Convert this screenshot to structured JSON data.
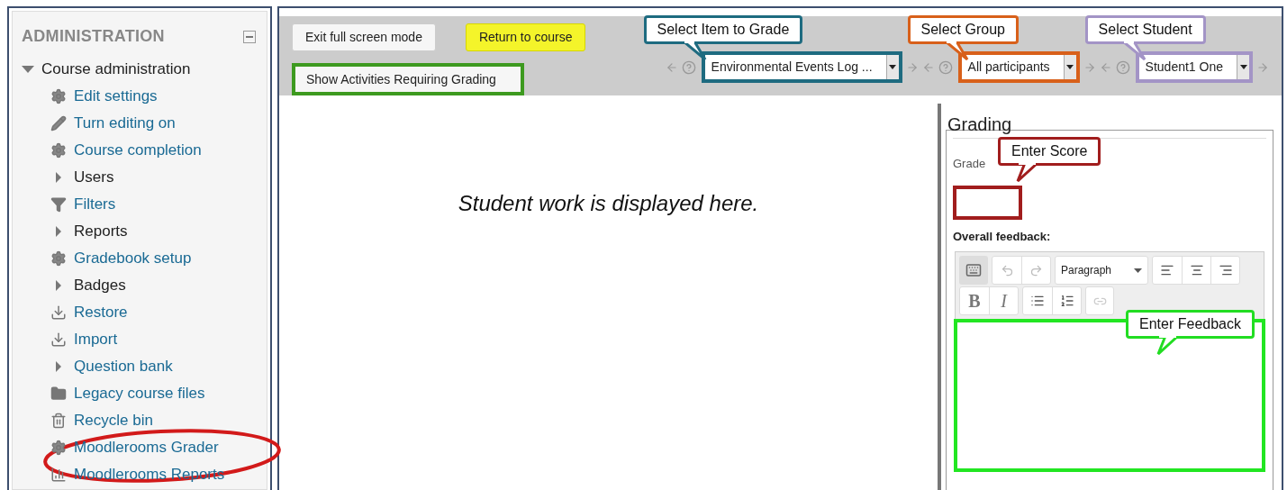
{
  "sidebar": {
    "title": "ADMINISTRATION",
    "section": {
      "label": "Course administration",
      "expanded": true
    },
    "items": [
      {
        "label": "Edit settings",
        "kind": "gear",
        "link": true
      },
      {
        "label": "Turn editing on",
        "kind": "pencil",
        "link": true
      },
      {
        "label": "Course completion",
        "kind": "gear",
        "link": true
      },
      {
        "label": "Users",
        "kind": "node",
        "link": false
      },
      {
        "label": "Filters",
        "kind": "filter",
        "link": true
      },
      {
        "label": "Reports",
        "kind": "node",
        "link": false
      },
      {
        "label": "Gradebook setup",
        "kind": "gear",
        "link": true
      },
      {
        "label": "Badges",
        "kind": "node",
        "link": false
      },
      {
        "label": "Restore",
        "kind": "download",
        "link": true
      },
      {
        "label": "Import",
        "kind": "download",
        "link": true
      },
      {
        "label": "Question bank",
        "kind": "node",
        "link": true
      },
      {
        "label": "Legacy course files",
        "kind": "folder",
        "link": true
      },
      {
        "label": "Recycle bin",
        "kind": "trash",
        "link": true
      },
      {
        "label": "Moodlerooms Grader",
        "kind": "gear",
        "link": true
      },
      {
        "label": "Moodlerooms Reports",
        "kind": "chart",
        "link": true
      }
    ]
  },
  "toolbar": {
    "buttons": [
      {
        "label": "Exit full screen mode",
        "kind": "default"
      },
      {
        "label": "Return to course",
        "kind": "highlight"
      }
    ],
    "activities_button": {
      "label": "Show Activities Requiring Grading",
      "color": "#3d9a1f"
    },
    "selectors": [
      {
        "value": "Environmental Events Log ...",
        "callout": "Select Item to Grade",
        "color": "#1e6b80"
      },
      {
        "value": "All participants",
        "callout": "Select Group",
        "color": "#d8601a"
      },
      {
        "value": "Student1 One",
        "callout": "Select Student",
        "color": "#a394c6"
      }
    ]
  },
  "main": {
    "message": "Student work is displayed here."
  },
  "grading": {
    "title": "Grading",
    "grade_label": "Grade",
    "score_callout": "Enter Score",
    "feedback_label": "Overall feedback:",
    "format": "Paragraph",
    "bold": "B",
    "italic": "I",
    "feedback_callout": "Enter Feedback"
  }
}
